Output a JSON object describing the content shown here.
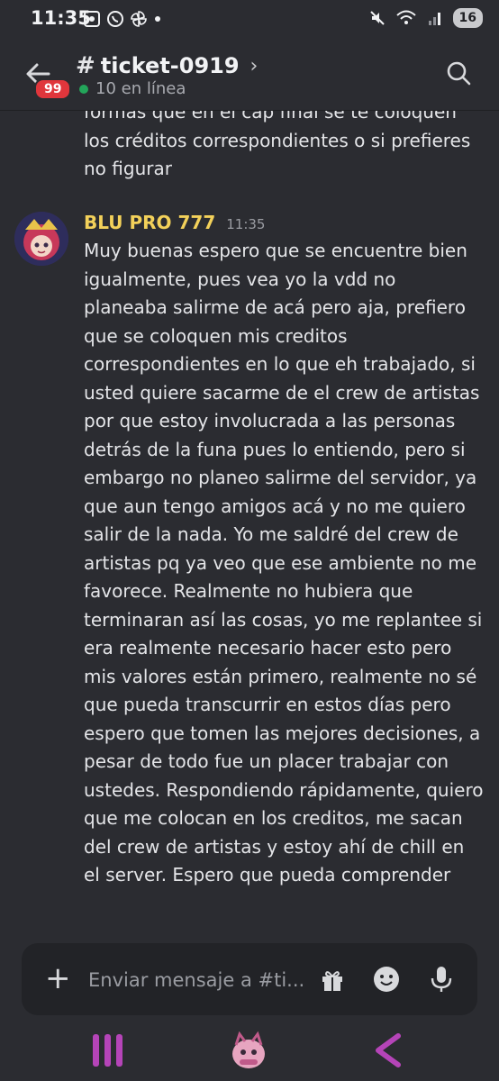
{
  "status_bar": {
    "time": "11:35",
    "battery": "16",
    "left_icons": [
      "screen-record-icon",
      "whatsapp-icon",
      "pinwheel-icon",
      "dot-icon"
    ],
    "right_icons": [
      "mute-icon",
      "wifi-icon",
      "signal-icon"
    ]
  },
  "header": {
    "back_badge": "99",
    "channel_name": "ticket-0919",
    "online_text": "10 en línea",
    "accent": "#23a55a"
  },
  "previous_message": {
    "text": "formas que en el cap final se te coloquen los créditos correspondientes o si prefieres no figurar"
  },
  "message": {
    "author": "BLU PRO 777",
    "timestamp": "11:35",
    "author_color": "#f3d15a",
    "text": "Muy buenas espero que se encuentre bien igualmente, pues vea yo la vdd no planeaba salirme de acá pero aja, prefiero que se coloquen mis creditos correspondientes en lo que eh trabajado, si usted quiere sacarme de el crew de artistas por que estoy involucrada a las personas detrás de la funa pues lo entiendo, pero si embargo no planeo salirme del servidor, ya que aun tengo amigos acá y no me quiero salir de la nada. Yo me saldré del crew de artistas pq ya veo que ese ambiente no me favorece. Realmente no hubiera que terminaran así las cosas, yo me replantee si era realmente necesario hacer esto pero mis valores están primero, realmente no sé que pueda transcurrir en estos días pero espero que tomen las mejores decisiones, a pesar de todo fue un placer trabajar con ustedes. Respondiendo rápidamente, quiero que me colocan en los creditos, me sacan del crew de artistas y estoy ahí de chill en el server. Espero que pueda comprender"
  },
  "composer": {
    "placeholder": "Enviar mensaje a #ti..."
  }
}
